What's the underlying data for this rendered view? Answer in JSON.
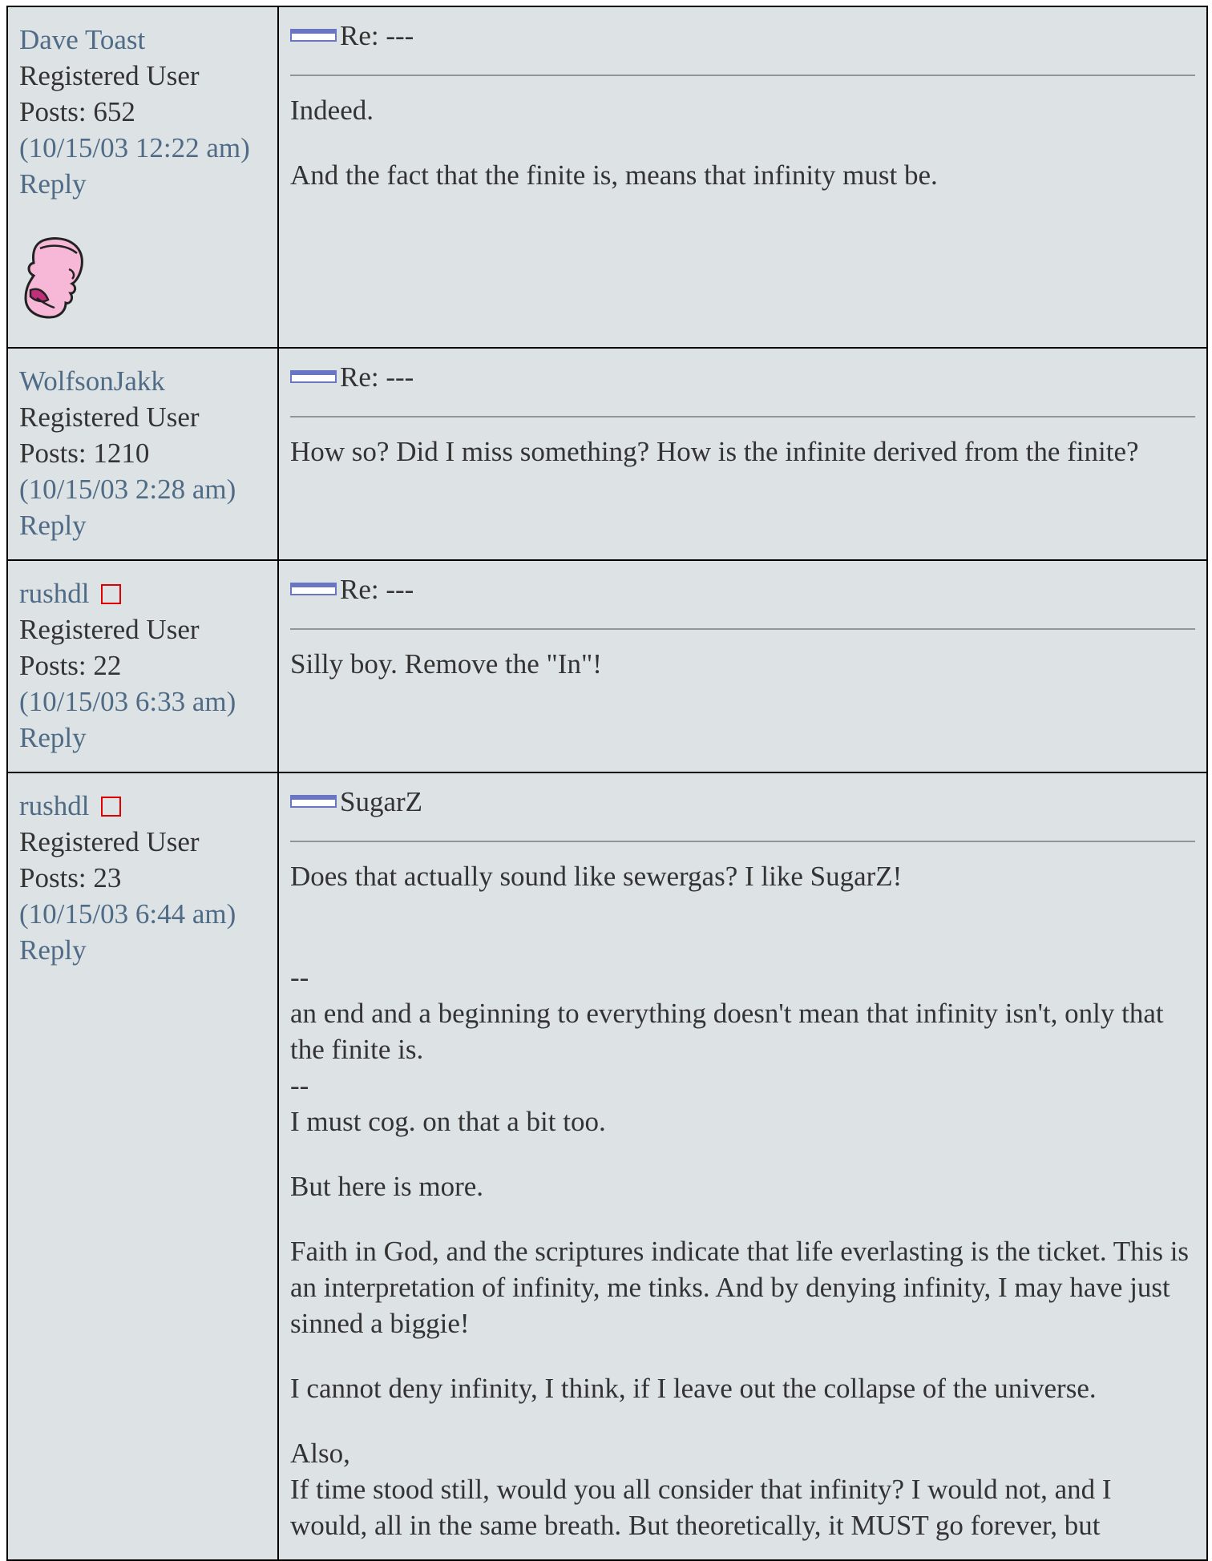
{
  "posts": [
    {
      "author": "Dave Toast",
      "role": "Registered User",
      "posts": "Posts: 652",
      "date": "(10/15/03 12:22 am)",
      "reply": "Reply",
      "subject": "Re: ---",
      "body": [
        "Indeed.",
        "And the fact that the finite is, means that infinity must be."
      ]
    },
    {
      "author": "WolfsonJakk",
      "role": "Registered User",
      "posts": "Posts: 1210",
      "date": "(10/15/03 2:28 am)",
      "reply": "Reply",
      "subject": "Re: ---",
      "body": [
        "How so? Did I miss something? How is the infinite derived from the finite?"
      ]
    },
    {
      "author": "rushdl",
      "role": "Registered User",
      "posts": "Posts: 22",
      "date": "(10/15/03 6:33 am)",
      "reply": "Reply",
      "subject": "Re: ---",
      "body": [
        "Silly boy. Remove the \"In\"!"
      ]
    },
    {
      "author": "rushdl",
      "role": "Registered User",
      "posts": "Posts: 23",
      "date": "(10/15/03 6:44 am)",
      "reply": "Reply",
      "subject": "SugarZ",
      "body": [
        "Does that actually sound like sewergas? I like SugarZ!",
        "\n--\nan end and a beginning to everything doesn't mean that infinity isn't, only that the finite is.\n--\nI must cog. on that a bit too.\n",
        "But here is more.",
        "Faith in God, and the scriptures indicate that life everlasting is the ticket. This is an interpretation of infinity, me tinks. And by denying infinity, I may have just sinned a biggie!",
        "I cannot deny infinity, I think, if I leave out the collapse of the universe.",
        "Also,\nIf time stood still, would you all consider that infinity? I would not, and I would, all in the same breath. But theoretically, it MUST go forever, but"
      ]
    }
  ],
  "colors": {
    "cell_bg": "#dde2e5",
    "link": "#4f6b86",
    "badge": "#e00000"
  },
  "icons": {
    "subject": "post-subject-icon",
    "status": "status-badge-icon",
    "avatar": "cartoon-head-avatar"
  }
}
